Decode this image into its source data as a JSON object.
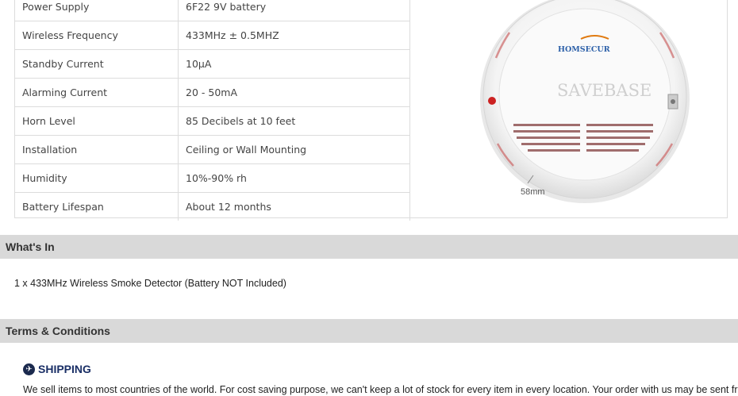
{
  "specs": [
    {
      "label": "Power Supply",
      "value": "6F22 9V battery"
    },
    {
      "label": "Wireless Frequency",
      "value": "433MHz ± 0.5MHZ"
    },
    {
      "label": "Standby Current",
      "value": "10μA"
    },
    {
      "label": "Alarming Current",
      "value": "20 - 50mA"
    },
    {
      "label": "Horn Level",
      "value": "85 Decibels at 10 feet"
    },
    {
      "label": "Installation",
      "value": "Ceiling or Wall Mounting"
    },
    {
      "label": "Humidity",
      "value": "10%-90% rh"
    },
    {
      "label": "Battery Lifespan",
      "value": "About 12 months"
    }
  ],
  "product_image": {
    "brand_logo": "HOMSECUR",
    "watermark": "SAVEBASE",
    "dimension": "58mm"
  },
  "whats_in": {
    "heading": "What's In",
    "text": "1 x 433MHz Wireless Smoke Detector (Battery NOT Included)"
  },
  "terms": {
    "heading": "Terms & Conditions",
    "shipping_icon": "airplane-icon",
    "shipping_heading": "SHIPPING",
    "shipping_text": "We sell items to most countries of the world. For cost saving purpose, we can't keep a lot of stock for every item in every location. Your order with us may be sent from"
  }
}
